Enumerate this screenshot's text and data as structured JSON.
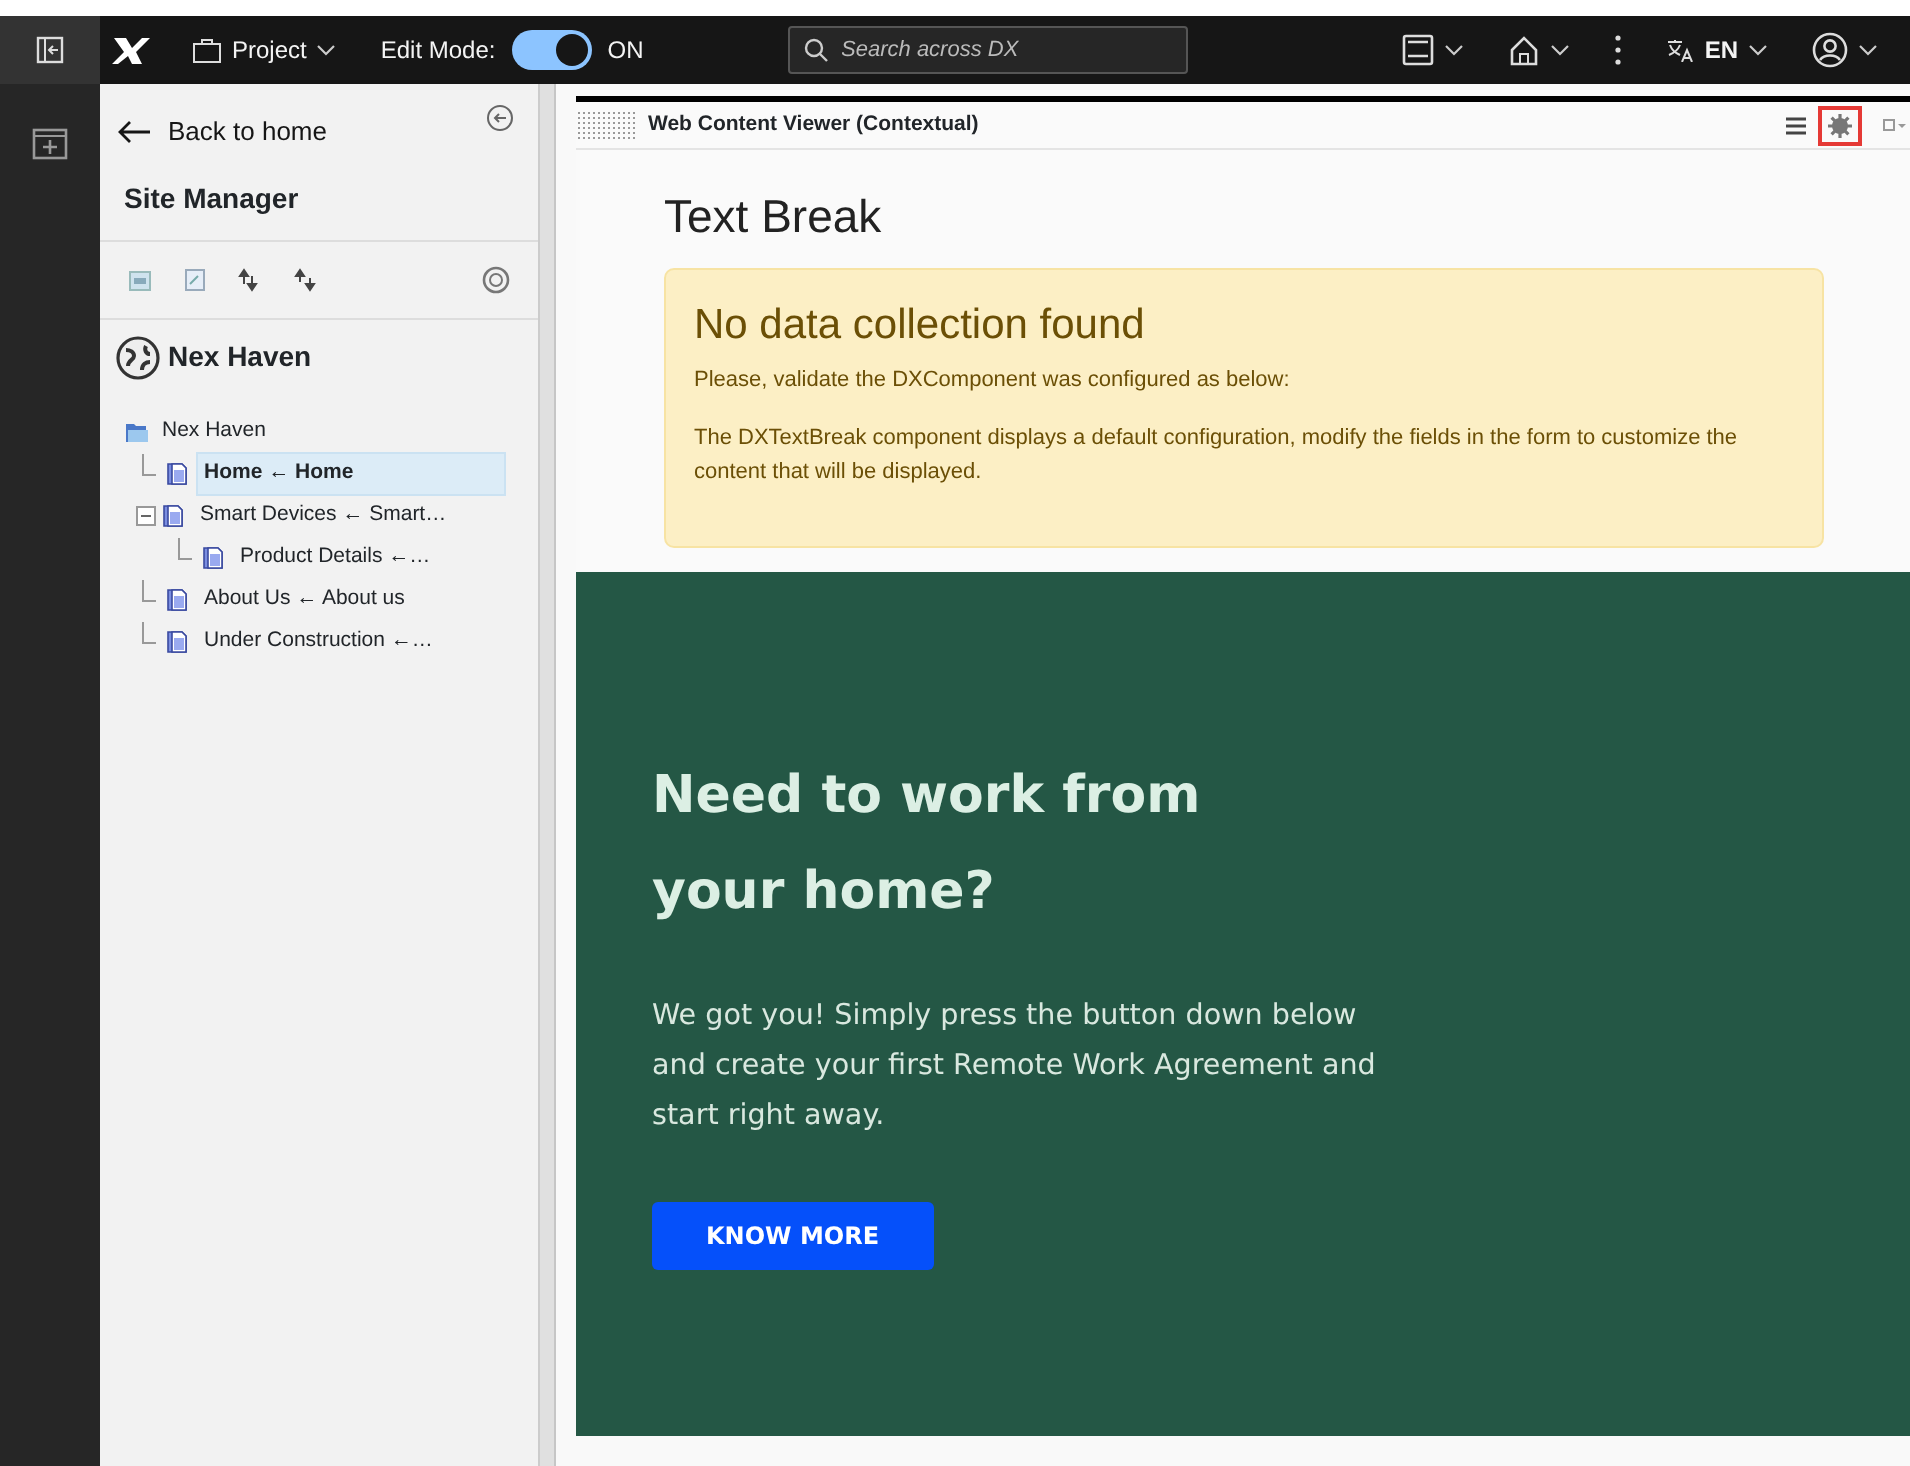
{
  "topbar": {
    "project": "Project",
    "edit_mode_label": "Edit Mode:",
    "edit_mode_on": true,
    "edit_mode_state": "ON",
    "search": {
      "placeholder": "Search across DX"
    },
    "language": "EN"
  },
  "sidebar": {
    "back": "Back to home",
    "title": "Site Manager",
    "site_name": "Nex Haven",
    "tree": [
      {
        "label": "Nex Haven",
        "selected": false,
        "children": [
          {
            "label": "Home ← Home",
            "selected": true
          },
          {
            "label": "Smart Devices ← Smart…",
            "selected": false,
            "expanded": true,
            "children": [
              {
                "label": "Product Details ←…",
                "selected": false
              }
            ]
          },
          {
            "label": "About Us ← About us",
            "selected": false
          },
          {
            "label": "Under Construction ←…",
            "selected": false
          }
        ]
      }
    ]
  },
  "portlet": {
    "title": "Web Content Viewer (Contextual)",
    "heading": "Text Break",
    "alert": {
      "title": "No data collection found",
      "lines": [
        "Please, validate the DXComponent was configured as below:",
        "The DXTextBreak component displays a default configuration, modify the fields in the form to customize the content that will be displayed."
      ]
    },
    "banner": {
      "heading": "Need to work from your home?",
      "text": "We got you! Simply press the button down below and create your first Remote Work Agreement and start right away.",
      "button": "KNOW MORE"
    }
  }
}
